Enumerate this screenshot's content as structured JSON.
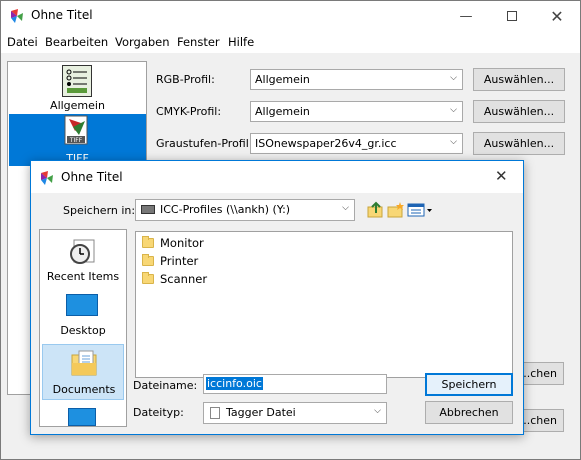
{
  "main": {
    "title": "Ohne Titel",
    "menu": [
      "Datei",
      "Bearbeiten",
      "Vorgaben",
      "Fenster",
      "Hilfe"
    ],
    "sidebar": [
      {
        "label": "Allgemein"
      },
      {
        "label": "TIFF"
      }
    ],
    "profiles": [
      {
        "label": "RGB-Profil:",
        "value": "Allgemein",
        "button": "Auswählen..."
      },
      {
        "label": "CMYK-Profil:",
        "value": "Allgemein",
        "button": "Auswählen..."
      },
      {
        "label": "Graustufen-Profil:",
        "value": "ISOnewspaper26v4_gr.icc",
        "button": "Auswählen..."
      }
    ],
    "partial_buttons": [
      "...chen",
      "...chen"
    ]
  },
  "dialog": {
    "title": "Ohne Titel",
    "save_in_label": "Speichern in:",
    "save_in_value": "ICC-Profiles (\\\\ankh) (Y:)",
    "places": [
      "Recent Items",
      "Desktop",
      "Documents",
      ""
    ],
    "files": [
      "Monitor",
      "Printer",
      "Scanner"
    ],
    "filename_label": "Dateiname:",
    "filename_value": "iccinfo.oic",
    "filetype_label": "Dateityp:",
    "filetype_value": "Tagger Datei",
    "save_button": "Speichern",
    "cancel_button": "Abbrechen"
  },
  "colors": {
    "accent": "#0078d7",
    "selection": "#cce4f7"
  }
}
